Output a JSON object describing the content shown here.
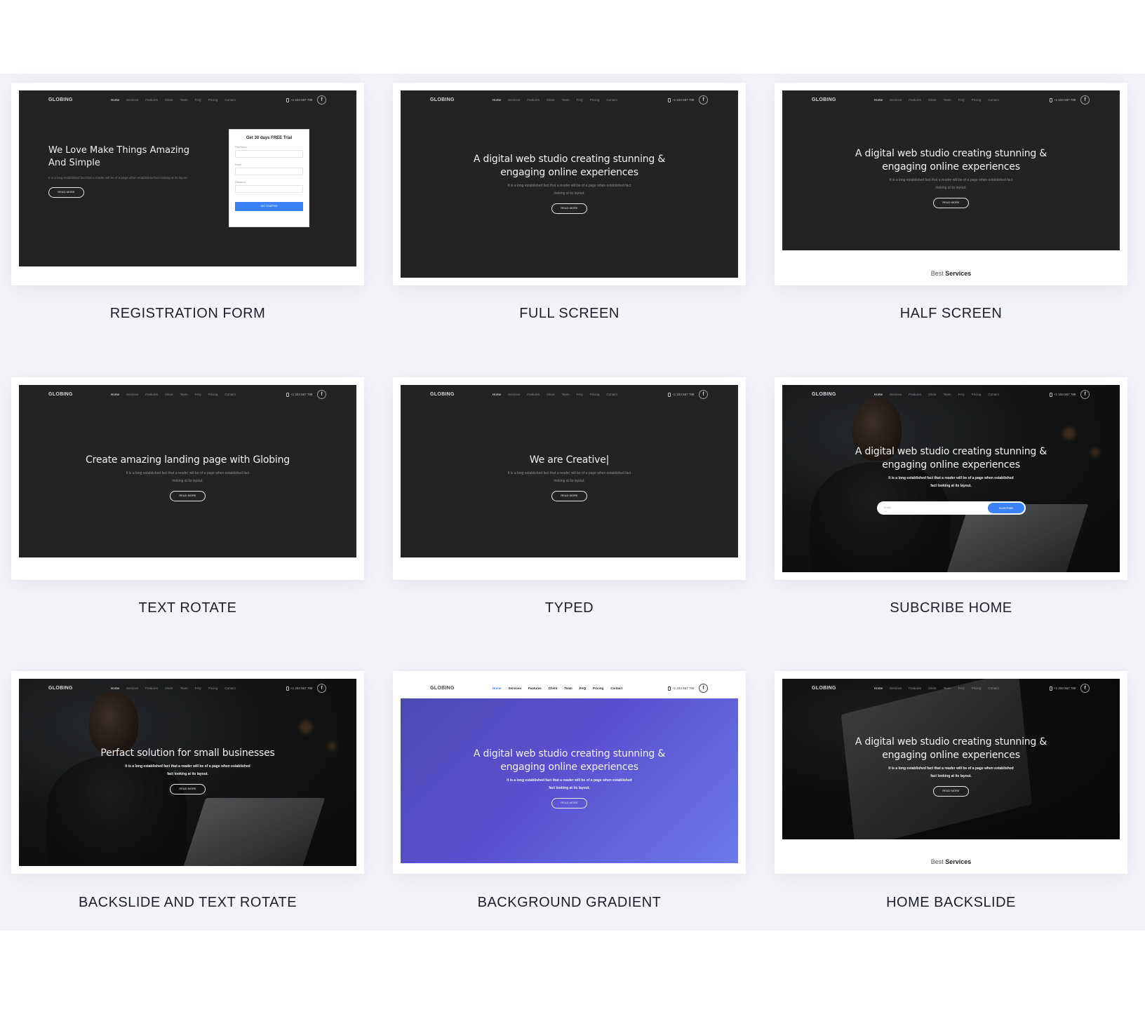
{
  "nav": {
    "logo": "GLOBING",
    "items": [
      "Home",
      "Services",
      "Features",
      "Client",
      "Team",
      "FAQ",
      "Pricing",
      "Contact"
    ],
    "phone": "+1 234 567 789",
    "fb": "f"
  },
  "common": {
    "headline": "A digital web studio creating stunning & engaging online experiences",
    "body": "It is a long established fact that a reader will be of a page when established fact looking at its layout.",
    "read_more": "READ MORE",
    "best": "Best",
    "services": "Services"
  },
  "registration": {
    "headline": "We Love Make Things Amazing And Simple",
    "body": "It is a long established fact that a reader will be of a page when established fact looking at its layout.",
    "form_title": "Get 30 days FREE Trial",
    "first_name": "First Name",
    "email": "Email",
    "password": "Password",
    "submit": "GET STARTED"
  },
  "text_rotate": {
    "headline": "Create amazing landing page with Globing"
  },
  "typed": {
    "headline": "We are Creative|"
  },
  "subscribe": {
    "placeholder": "Email",
    "button": "SUBCRIBE"
  },
  "backslide_rotate": {
    "headline": "Perfact solution for small businesses"
  },
  "captions": {
    "c1": "REGISTRATION FORM",
    "c2": "FULL SCREEN",
    "c3": "HALF SCREEN",
    "c4": "TEXT ROTATE",
    "c5": "TYPED",
    "c6": "SUBCRIBE HOME",
    "c7": "BACKSLIDE AND TEXT ROTATE",
    "c8": "BACKGROUND GRADIENT",
    "c9": "HOME BACKSLIDE"
  },
  "colors": {
    "page_band": "#f3f4f8",
    "hero_dark": "#232323",
    "accent_blue": "#3b82f6",
    "gradient_start": "#4e4ab3",
    "gradient_end": "#6b7be8"
  }
}
